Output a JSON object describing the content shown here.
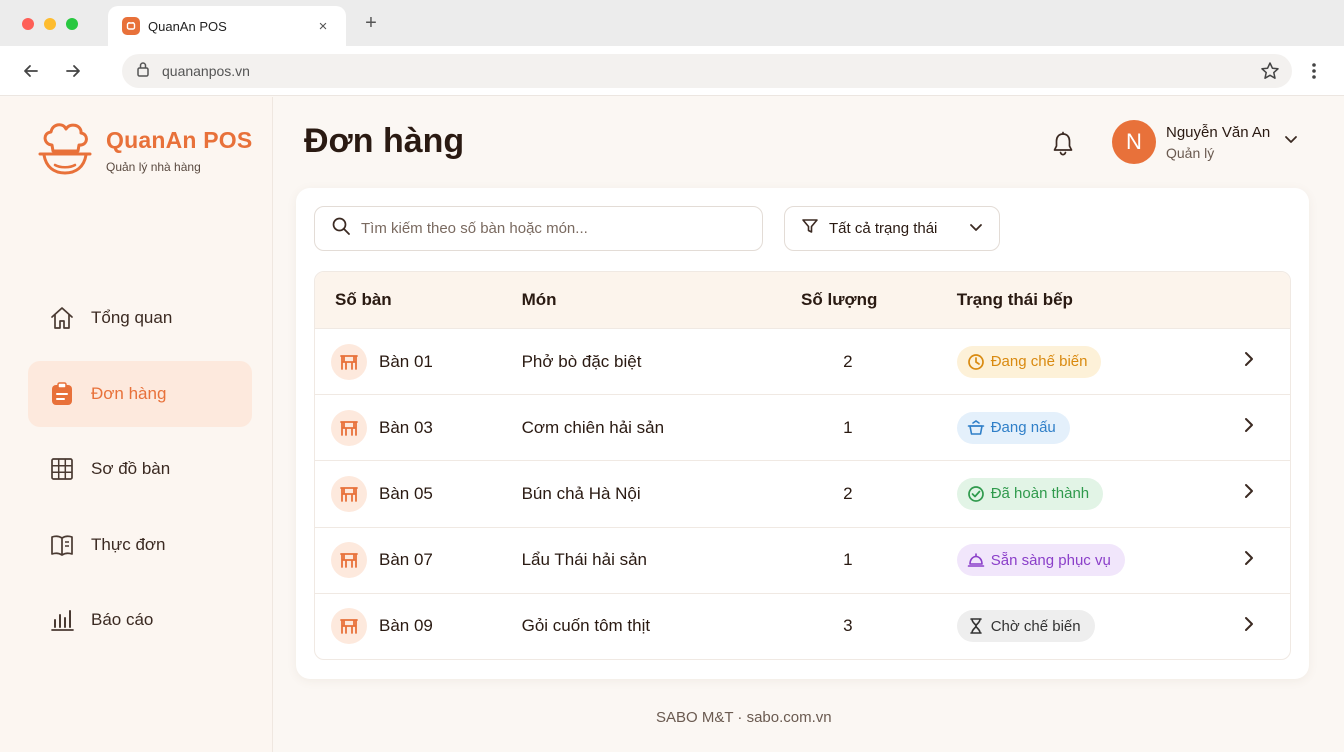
{
  "browser": {
    "tab_title": "QuanAn POS",
    "url": "quananpos.vn",
    "controls": {
      "close": "×",
      "new_tab": "+"
    }
  },
  "brand": {
    "title": "QuanAn POS",
    "subtitle": "Quản lý nhà hàng",
    "accent": "#e8713a"
  },
  "sidebar": {
    "items": [
      {
        "label": "Tổng quan",
        "icon": "home-icon",
        "active": false
      },
      {
        "label": "Đơn hàng",
        "icon": "clipboard-icon",
        "active": true
      },
      {
        "label": "Sơ đồ bàn",
        "icon": "grid-icon",
        "active": false
      },
      {
        "label": "Thực đơn",
        "icon": "book-icon",
        "active": false
      },
      {
        "label": "Báo cáo",
        "icon": "bar-chart-icon",
        "active": false
      }
    ]
  },
  "header": {
    "title": "Đơn hàng",
    "user": {
      "initial": "N",
      "name": "Nguyễn Văn An",
      "role": "Quản lý"
    }
  },
  "toolbar": {
    "search_placeholder": "Tìm kiếm theo số bàn hoặc món...",
    "filter_label": "Tất cả trạng thái"
  },
  "table": {
    "columns": [
      "Số bàn",
      "Món",
      "Số lượng",
      "Trạng thái bếp"
    ],
    "rows": [
      {
        "table": "Bàn 01",
        "dish": "Phở bò đặc biệt",
        "qty": "2",
        "status": "Đang chế biến",
        "status_icon": "clock-icon",
        "status_bg": "#fdf1d8",
        "status_fg": "#d98a10"
      },
      {
        "table": "Bàn 03",
        "dish": "Cơm chiên hải sản",
        "qty": "1",
        "status": "Đang nấu",
        "status_icon": "pot-icon",
        "status_bg": "#e4f0fb",
        "status_fg": "#2f7fc8"
      },
      {
        "table": "Bàn 05",
        "dish": "Bún chả Hà Nội",
        "qty": "2",
        "status": "Đã hoàn thành",
        "status_icon": "check-circle-icon",
        "status_bg": "#e2f4e6",
        "status_fg": "#2f9a4c"
      },
      {
        "table": "Bàn 07",
        "dish": "Lẩu Thái hải sản",
        "qty": "1",
        "status": "Sẵn sàng phục vụ",
        "status_icon": "cloche-icon",
        "status_bg": "#f1e6fb",
        "status_fg": "#8b3fc9"
      },
      {
        "table": "Bàn 09",
        "dish": "Gỏi cuốn tôm thịt",
        "qty": "3",
        "status": "Chờ chế biến",
        "status_icon": "hourglass-icon",
        "status_bg": "#eeeeee",
        "status_fg": "#333333"
      }
    ]
  },
  "footer": {
    "text": "SABO M&T · sabo.com.vn"
  }
}
